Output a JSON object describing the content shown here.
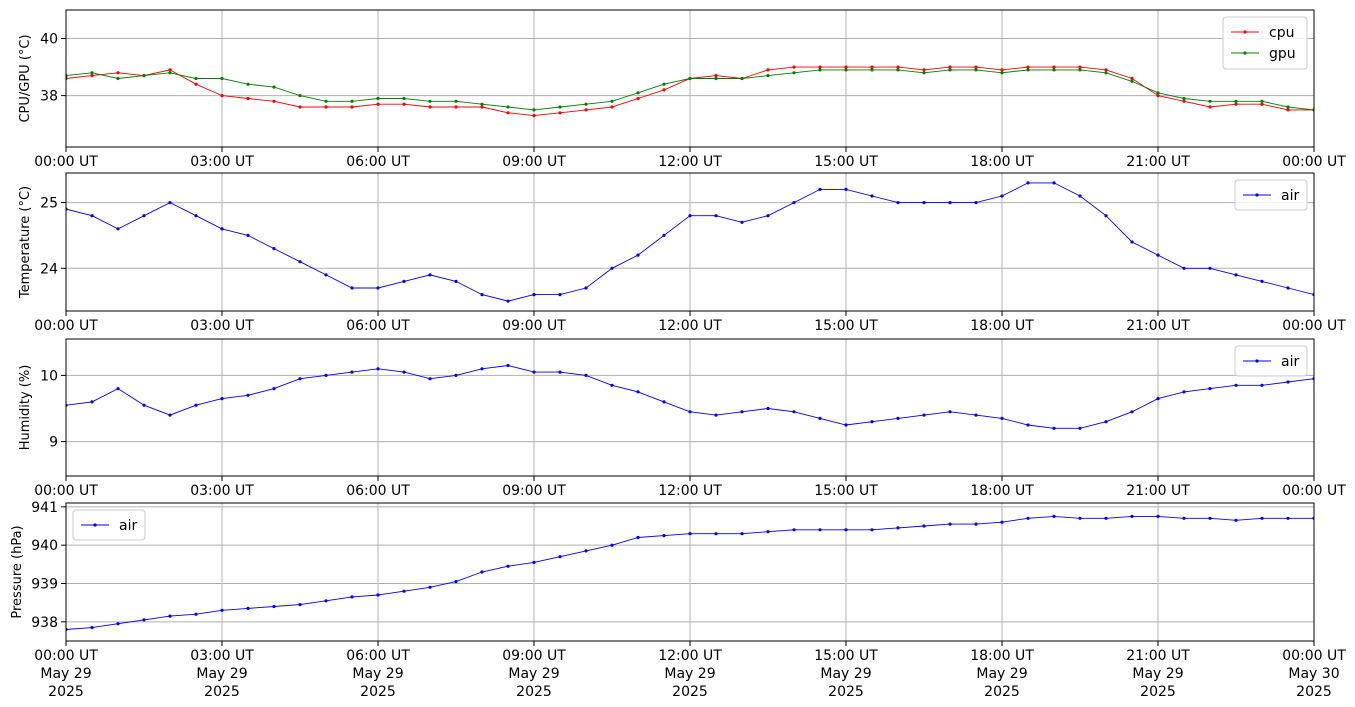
{
  "x_ticks": [
    "00:00 UT",
    "03:00 UT",
    "06:00 UT",
    "09:00 UT",
    "12:00 UT",
    "15:00 UT",
    "18:00 UT",
    "21:00 UT",
    "00:00 UT"
  ],
  "x_date_labels": [
    [
      "May 29",
      "2025"
    ],
    [
      "May 29",
      "2025"
    ],
    [
      "May 29",
      "2025"
    ],
    [
      "May 29",
      "2025"
    ],
    [
      "May 29",
      "2025"
    ],
    [
      "May 29",
      "2025"
    ],
    [
      "May 29",
      "2025"
    ],
    [
      "May 29",
      "2025"
    ],
    [
      "May 30",
      "2025"
    ]
  ],
  "colors": {
    "cpu": "#ff0000",
    "gpu": "#008000",
    "air": "#0000ff",
    "grid": "#b0b0b0"
  },
  "chart_data": [
    {
      "type": "line",
      "ylabel": "CPU/GPU (°C)",
      "ylim": [
        36.2,
        41.0
      ],
      "yticks": [
        38,
        40
      ],
      "xlim_hours": [
        0,
        24
      ],
      "legend": "top-right",
      "grid": true,
      "series": [
        {
          "name": "cpu",
          "color": "#ff0000",
          "x_hours": [
            0,
            0.5,
            1.0,
            1.5,
            2.0,
            2.5,
            3.0,
            3.5,
            4.0,
            4.5,
            5.0,
            5.5,
            6.0,
            6.5,
            7.0,
            7.5,
            8.0,
            8.5,
            9.0,
            9.5,
            10.0,
            10.5,
            11.0,
            11.5,
            12.0,
            12.5,
            13.0,
            13.5,
            14.0,
            14.5,
            15.0,
            15.5,
            16.0,
            16.5,
            17.0,
            17.5,
            18.0,
            18.5,
            19.0,
            19.5,
            20.0,
            20.5,
            21.0,
            21.5,
            22.0,
            22.5,
            23.0,
            23.5,
            24.0
          ],
          "values": [
            38.6,
            38.7,
            38.8,
            38.7,
            38.9,
            38.4,
            38.0,
            37.9,
            37.8,
            37.6,
            37.6,
            37.6,
            37.7,
            37.7,
            37.6,
            37.6,
            37.6,
            37.4,
            37.3,
            37.4,
            37.5,
            37.6,
            37.9,
            38.2,
            38.6,
            38.7,
            38.6,
            38.9,
            39.0,
            39.0,
            39.0,
            39.0,
            39.0,
            38.9,
            39.0,
            39.0,
            38.9,
            39.0,
            39.0,
            39.0,
            38.9,
            38.6,
            38.0,
            37.8,
            37.6,
            37.7,
            37.7,
            37.5,
            37.5
          ]
        },
        {
          "name": "gpu",
          "color": "#008000",
          "x_hours": [
            0,
            0.5,
            1.0,
            1.5,
            2.0,
            2.5,
            3.0,
            3.5,
            4.0,
            4.5,
            5.0,
            5.5,
            6.0,
            6.5,
            7.0,
            7.5,
            8.0,
            8.5,
            9.0,
            9.5,
            10.0,
            10.5,
            11.0,
            11.5,
            12.0,
            12.5,
            13.0,
            13.5,
            14.0,
            14.5,
            15.0,
            15.5,
            16.0,
            16.5,
            17.0,
            17.5,
            18.0,
            18.5,
            19.0,
            19.5,
            20.0,
            20.5,
            21.0,
            21.5,
            22.0,
            22.5,
            23.0,
            23.5,
            24.0
          ],
          "values": [
            38.7,
            38.8,
            38.6,
            38.7,
            38.8,
            38.6,
            38.6,
            38.4,
            38.3,
            38.0,
            37.8,
            37.8,
            37.9,
            37.9,
            37.8,
            37.8,
            37.7,
            37.6,
            37.5,
            37.6,
            37.7,
            37.8,
            38.1,
            38.4,
            38.6,
            38.6,
            38.6,
            38.7,
            38.8,
            38.9,
            38.9,
            38.9,
            38.9,
            38.8,
            38.9,
            38.9,
            38.8,
            38.9,
            38.9,
            38.9,
            38.8,
            38.5,
            38.1,
            37.9,
            37.8,
            37.8,
            37.8,
            37.6,
            37.5
          ]
        }
      ]
    },
    {
      "type": "line",
      "ylabel": "Temperature (°C)",
      "ylim": [
        23.35,
        25.45
      ],
      "yticks": [
        24,
        25
      ],
      "xlim_hours": [
        0,
        24
      ],
      "legend": "top-right",
      "grid": true,
      "series": [
        {
          "name": "air",
          "color": "#0000ff",
          "x_hours": [
            0,
            0.5,
            1.0,
            1.5,
            2.0,
            2.5,
            3.0,
            3.5,
            4.0,
            4.5,
            5.0,
            5.5,
            6.0,
            6.5,
            7.0,
            7.5,
            8.0,
            8.5,
            9.0,
            9.5,
            10.0,
            10.5,
            11.0,
            11.5,
            12.0,
            12.5,
            13.0,
            13.5,
            14.0,
            14.5,
            15.0,
            15.5,
            16.0,
            16.5,
            17.0,
            17.5,
            18.0,
            18.5,
            19.0,
            19.5,
            20.0,
            20.5,
            21.0,
            21.5,
            22.0,
            22.5,
            23.0,
            23.5,
            24.0
          ],
          "values": [
            24.9,
            24.8,
            24.6,
            24.8,
            25.0,
            24.8,
            24.6,
            24.5,
            24.3,
            24.1,
            23.9,
            23.7,
            23.7,
            23.8,
            23.9,
            23.8,
            23.6,
            23.5,
            23.6,
            23.6,
            23.7,
            24.0,
            24.2,
            24.5,
            24.8,
            24.8,
            24.7,
            24.8,
            25.0,
            25.2,
            25.2,
            25.1,
            25.0,
            25.0,
            25.0,
            25.0,
            25.1,
            25.3,
            25.3,
            25.1,
            24.8,
            24.4,
            24.2,
            24.0,
            24.0,
            23.9,
            23.8,
            23.7,
            23.6
          ]
        }
      ]
    },
    {
      "type": "line",
      "ylabel": "Humidity (%)",
      "ylim": [
        8.48,
        10.55
      ],
      "yticks": [
        9,
        10
      ],
      "xlim_hours": [
        0,
        24
      ],
      "legend": "top-right",
      "grid": true,
      "series": [
        {
          "name": "air",
          "color": "#0000ff",
          "x_hours": [
            0,
            0.5,
            1.0,
            1.5,
            2.0,
            2.5,
            3.0,
            3.5,
            4.0,
            4.5,
            5.0,
            5.5,
            6.0,
            6.5,
            7.0,
            7.5,
            8.0,
            8.5,
            9.0,
            9.5,
            10.0,
            10.5,
            11.0,
            11.5,
            12.0,
            12.5,
            13.0,
            13.5,
            14.0,
            14.5,
            15.0,
            15.5,
            16.0,
            16.5,
            17.0,
            17.5,
            18.0,
            18.5,
            19.0,
            19.5,
            20.0,
            20.5,
            21.0,
            21.5,
            22.0,
            22.5,
            23.0,
            23.5,
            24.0
          ],
          "values": [
            9.55,
            9.6,
            9.8,
            9.55,
            9.4,
            9.55,
            9.65,
            9.7,
            9.8,
            9.95,
            10.0,
            10.05,
            10.1,
            10.05,
            9.95,
            10.0,
            10.1,
            10.15,
            10.05,
            10.05,
            10.0,
            9.85,
            9.75,
            9.6,
            9.45,
            9.4,
            9.45,
            9.5,
            9.45,
            9.35,
            9.25,
            9.3,
            9.35,
            9.4,
            9.45,
            9.4,
            9.35,
            9.25,
            9.2,
            9.2,
            9.3,
            9.45,
            9.65,
            9.75,
            9.8,
            9.85,
            9.85,
            9.9,
            9.95
          ]
        }
      ]
    },
    {
      "type": "line",
      "ylabel": "Pressure (hPa)",
      "ylim": [
        937.5,
        941.1
      ],
      "yticks": [
        938,
        939,
        940,
        941
      ],
      "xlim_hours": [
        0,
        24
      ],
      "legend": "top-left",
      "grid": true,
      "series": [
        {
          "name": "air",
          "color": "#0000ff",
          "x_hours": [
            0,
            0.5,
            1.0,
            1.5,
            2.0,
            2.5,
            3.0,
            3.5,
            4.0,
            4.5,
            5.0,
            5.5,
            6.0,
            6.5,
            7.0,
            7.5,
            8.0,
            8.5,
            9.0,
            9.5,
            10.0,
            10.5,
            11.0,
            11.5,
            12.0,
            12.5,
            13.0,
            13.5,
            14.0,
            14.5,
            15.0,
            15.5,
            16.0,
            16.5,
            17.0,
            17.5,
            18.0,
            18.5,
            19.0,
            19.5,
            20.0,
            20.5,
            21.0,
            21.5,
            22.0,
            22.5,
            23.0,
            23.5,
            24.0
          ],
          "values": [
            937.8,
            937.85,
            937.95,
            938.05,
            938.15,
            938.2,
            938.3,
            938.35,
            938.4,
            938.45,
            938.55,
            938.65,
            938.7,
            938.8,
            938.9,
            939.05,
            939.3,
            939.45,
            939.55,
            939.7,
            939.85,
            940.0,
            940.2,
            940.25,
            940.3,
            940.3,
            940.3,
            940.35,
            940.4,
            940.4,
            940.4,
            940.4,
            940.45,
            940.5,
            940.55,
            940.55,
            940.6,
            940.7,
            940.75,
            940.7,
            940.7,
            940.75,
            940.75,
            940.7,
            940.7,
            940.65,
            940.7,
            940.7,
            940.7
          ]
        }
      ]
    }
  ]
}
